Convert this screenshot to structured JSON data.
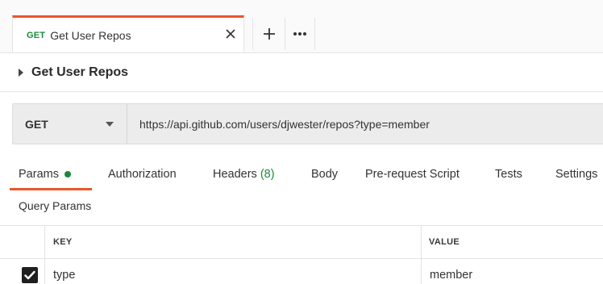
{
  "tabs": {
    "active": {
      "method": "GET",
      "title": "Get User Repos",
      "close_icon": "close-icon"
    },
    "new_tab_icon": "plus-icon",
    "more_icon": "ellipsis-icon"
  },
  "request": {
    "name": "Get User Repos",
    "method": "GET",
    "url": "https://api.github.com/users/djwester/repos?type=member"
  },
  "subtabs": [
    {
      "label": "Params",
      "indicator": "dot",
      "active": true
    },
    {
      "label": "Authorization"
    },
    {
      "label": "Headers",
      "count": "(8)"
    },
    {
      "label": "Body"
    },
    {
      "label": "Pre-request Script"
    },
    {
      "label": "Tests"
    },
    {
      "label": "Settings"
    }
  ],
  "query_params": {
    "title": "Query Params",
    "columns": [
      "KEY",
      "VALUE"
    ],
    "rows": [
      {
        "checked": true,
        "key": "type",
        "value": "member"
      }
    ]
  },
  "colors": {
    "accent": "#e8562a",
    "method_green": "#1a8a3a"
  }
}
